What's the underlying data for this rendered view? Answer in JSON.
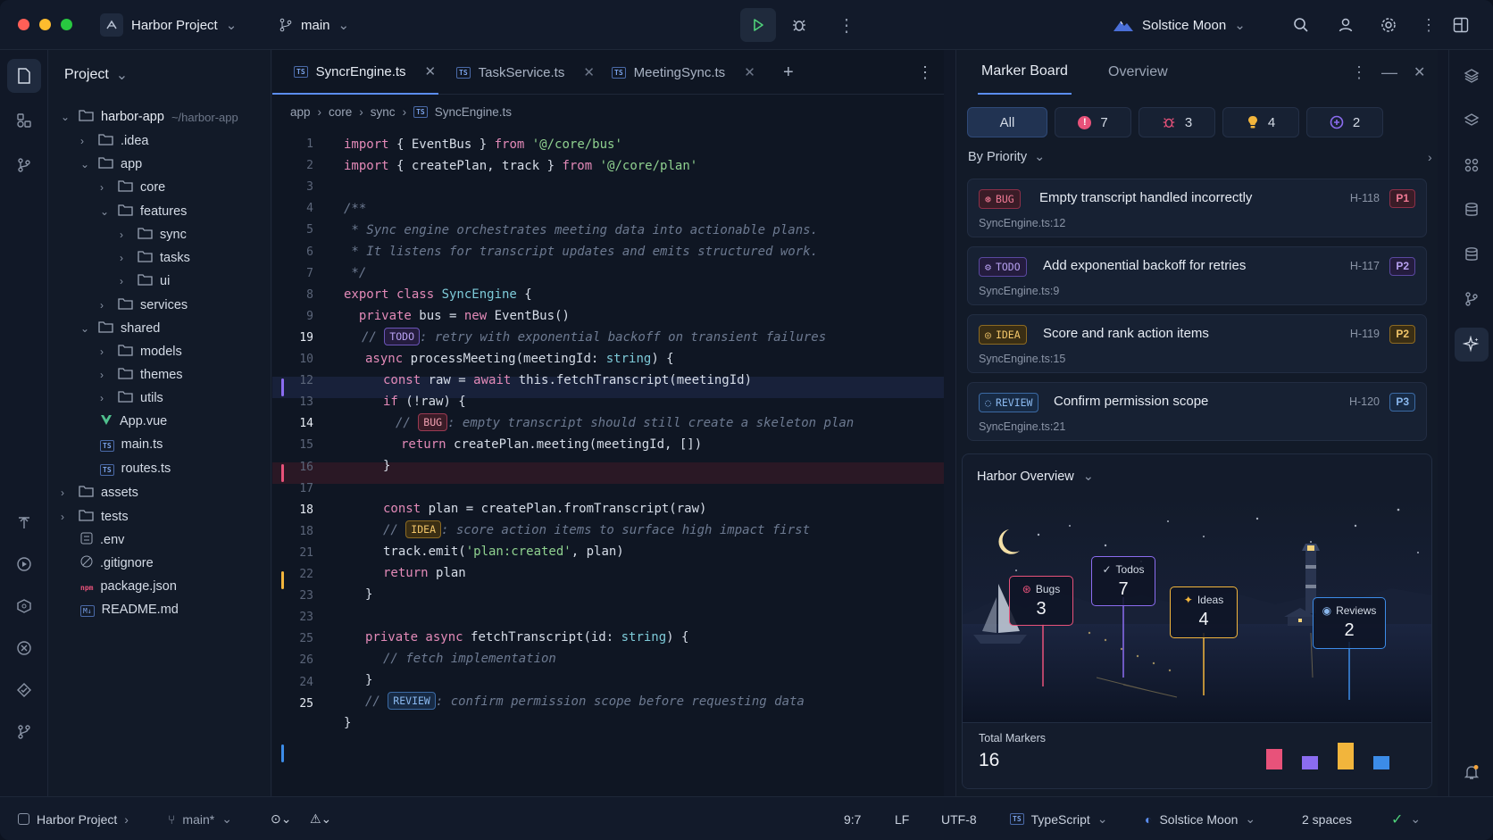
{
  "window": {
    "project": "Harbor Project",
    "branch": "main",
    "theme": "Solstice Moon"
  },
  "sidebar": {
    "title": "Project"
  },
  "tree": [
    {
      "label": "harbor-app",
      "hint": "~/harbor-app"
    },
    {
      "label": ".idea"
    },
    {
      "label": "app"
    },
    {
      "label": "core"
    },
    {
      "label": "features"
    },
    {
      "label": "sync"
    },
    {
      "label": "tasks"
    },
    {
      "label": "ui"
    },
    {
      "label": "services"
    },
    {
      "label": "shared"
    },
    {
      "label": "models"
    },
    {
      "label": "themes"
    },
    {
      "label": "utils"
    },
    {
      "label": "App.vue"
    },
    {
      "label": "main.ts"
    },
    {
      "label": "routes.ts"
    },
    {
      "label": "assets"
    },
    {
      "label": "tests"
    },
    {
      "label": ".env"
    },
    {
      "label": ".gitignore"
    },
    {
      "label": "package.json"
    },
    {
      "label": "README.md"
    }
  ],
  "tabs": [
    {
      "label": "SyncrEngine.ts"
    },
    {
      "label": "TaskService.ts"
    },
    {
      "label": "MeetingSync.ts"
    }
  ],
  "breadcrumb": [
    "app",
    "core",
    "sync",
    "SyncEngine.ts"
  ],
  "code": {
    "line_numbers": [
      "1",
      "2",
      "3",
      "4",
      "5",
      "6",
      "7",
      "8",
      "9",
      "19",
      "10",
      "12",
      "13",
      "14",
      "15",
      "16",
      "17",
      "18",
      "18",
      "21",
      "22",
      "23",
      "23",
      "25",
      "26",
      "24",
      "25"
    ],
    "l1": {
      "kw": "import",
      "mid": " { EventBus } ",
      "kw2": "from",
      "str": " '@/core/bus'"
    },
    "l2": {
      "kw": "import",
      "mid": " { createPlan, track } ",
      "kw2": "from",
      "str": " '@/core/plan'"
    },
    "l4": "/**",
    "l5": " * Sync engine orchestrates meeting data into actionable plans.",
    "l6": " * It listens for transcript updates and emits structured work.",
    "l7": " */",
    "l8": {
      "kw": "export class ",
      "name": "SyncEngine",
      "rest": " {"
    },
    "l9": {
      "kw": "  private ",
      "rest": "bus = ",
      "kw2": "new ",
      "rest2": "EventBus()"
    },
    "l10": {
      "pre": "// ",
      "tag": "TODO",
      "text": ": retry with exponential backoff on transient failures"
    },
    "l11": {
      "kw": "async ",
      "rest": "processMeeting(meetingId: ",
      "type": "string",
      "rest2": ") {"
    },
    "l12": {
      "kw": "const ",
      "rest": "raw = ",
      "kw2": "await ",
      "rest2": "this.fetchTranscript(meetingId)"
    },
    "l13": {
      "kw": "if ",
      "rest": "(!raw) {"
    },
    "l14": {
      "pre": "// ",
      "tag": "BUG",
      "text": ": empty transcript should still create a skeleton plan"
    },
    "l15": {
      "kw": "return ",
      "rest": "createPlan.meeting(meetingId, [])"
    },
    "l16": "}",
    "l18": {
      "kw": "const ",
      "rest": "plan = createPlan.fromTranscript(raw)"
    },
    "l19": {
      "pre": "// ",
      "tag": "IDEA",
      "text": ": score action items to surface high impact first"
    },
    "l20": {
      "rest": "track.emit(",
      "str": "'plan:created'",
      "rest2": ", plan)"
    },
    "l21": {
      "kw": "return ",
      "rest": "plan"
    },
    "l22": "}",
    "l24": {
      "kw": "private async ",
      "rest": "fetchTranscript(id: ",
      "type": "string",
      "rest2": ") {"
    },
    "l25": "// fetch implementation",
    "l26": "}",
    "l27": {
      "pre": "// ",
      "tag": "REVIEW",
      "text": ": confirm permission scope before requesting data"
    },
    "l28": "}"
  },
  "marker_board": {
    "tabs": [
      "Marker Board",
      "Overview"
    ],
    "filters": {
      "all": "All",
      "errors": "7",
      "bugs": "3",
      "ideas": "4",
      "reviews": "2"
    },
    "group": "By Priority",
    "cards": [
      {
        "tag": "BUG",
        "title": "Empty transcript handled incorrectly",
        "file": "SyncEngine.ts:12",
        "id": "H-118",
        "priority": "P1"
      },
      {
        "tag": "TODO",
        "title": "Add exponential backoff for retries",
        "file": "SyncEngine.ts:9",
        "id": "H-117",
        "priority": "P2"
      },
      {
        "tag": "IDEA",
        "title": "Score and rank action items",
        "file": "SyncEngine.ts:15",
        "id": "H-119",
        "priority": "P2"
      },
      {
        "tag": "REVIEW",
        "title": "Confirm permission scope",
        "file": "SyncEngine.ts:21",
        "id": "H-120",
        "priority": "P3"
      }
    ]
  },
  "overview": {
    "title": "Harbor Overview",
    "stats": {
      "bugs": {
        "label": "Bugs",
        "value": "3"
      },
      "todos": {
        "label": "Todos",
        "value": "7"
      },
      "ideas": {
        "label": "Ideas",
        "value": "4"
      },
      "reviews": {
        "label": "Reviews",
        "value": "2"
      }
    },
    "total_label": "Total Markers",
    "total": "16",
    "mini_bars": {
      "bugs": 3,
      "todos": 2,
      "ideas": 4,
      "reviews": 2
    }
  },
  "status": {
    "project": "Harbor Project",
    "branch": "main*",
    "position": "9:7",
    "eol": "LF",
    "encoding": "UTF-8",
    "language": "TypeScript",
    "theme": "Solstice Moon",
    "indent": "2 spaces"
  },
  "colors": {
    "bug": "#e8527a",
    "todo": "#8b6cf0",
    "idea": "#f2b53c",
    "review": "#3c8ce8",
    "accent": "#5b8def"
  }
}
